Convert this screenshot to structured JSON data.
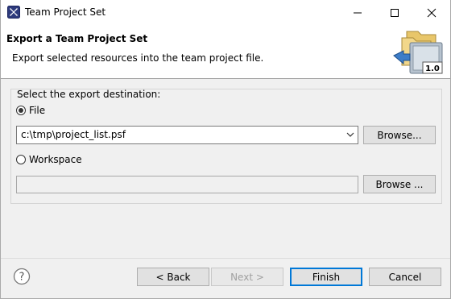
{
  "window": {
    "title": "Team Project Set",
    "app_icon": "eclipse-x-icon",
    "controls": [
      "minimize-icon",
      "maximize-icon",
      "close-icon"
    ]
  },
  "header": {
    "title": "Export a Team Project Set",
    "description": "Export selected resources into the team project file.",
    "image_badge": "1.0"
  },
  "destination": {
    "group_label": "Select the export destination:",
    "file_option": {
      "label": "File",
      "checked": true
    },
    "file_path": "c:\\tmp\\project_list.psf",
    "file_browse_label": "Browse...",
    "workspace_option": {
      "label": "Workspace",
      "checked": false
    },
    "workspace_path": "",
    "workspace_browse_label": "Browse ..."
  },
  "footer": {
    "help_icon": "help-icon",
    "back_label": "< Back",
    "next_label": "Next >",
    "finish_label": "Finish",
    "cancel_label": "Cancel"
  },
  "colors": {
    "default_button_border": "#0078d7",
    "dialog_background": "#f0f0f0",
    "banner_background": "#ffffff"
  }
}
